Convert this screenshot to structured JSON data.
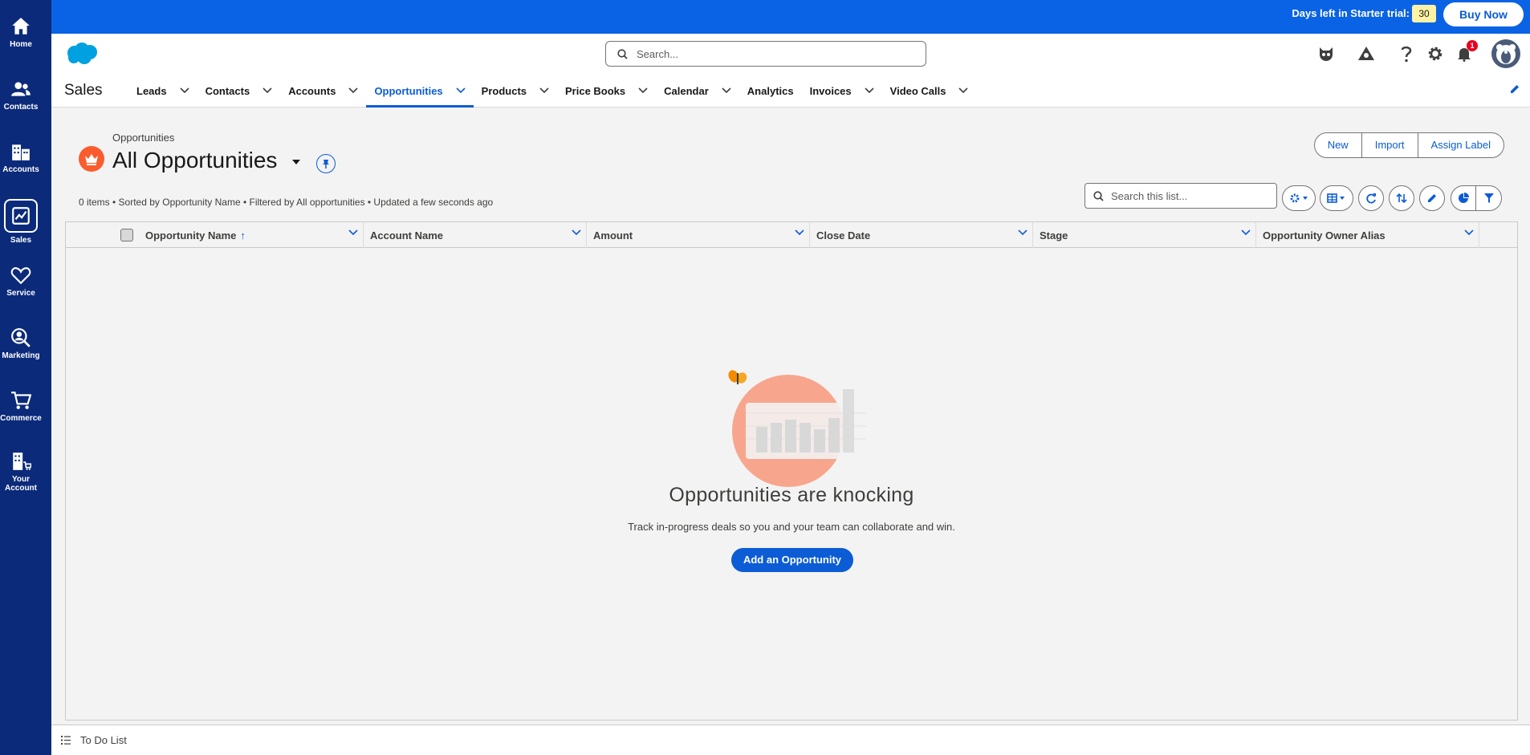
{
  "rail": {
    "items": [
      {
        "label": "Home",
        "icon": "home-icon"
      },
      {
        "label": "Contacts",
        "icon": "people-icon"
      },
      {
        "label": "Accounts",
        "icon": "building-icon"
      },
      {
        "label": "Sales",
        "icon": "chart-icon"
      },
      {
        "label": "Service",
        "icon": "heart-icon"
      },
      {
        "label": "Marketing",
        "icon": "search-person-icon"
      },
      {
        "label": "Commerce",
        "icon": "cart-icon"
      },
      {
        "label": "Your",
        "label2": "Account",
        "icon": "building-cart-icon"
      }
    ]
  },
  "trial": {
    "text": "Days left in Starter trial:",
    "days": "30",
    "buy": "Buy Now"
  },
  "header": {
    "search_placeholder": "Search...",
    "notification_count": "1"
  },
  "app": {
    "name": "Sales"
  },
  "nav": {
    "items": [
      "Leads",
      "Contacts",
      "Accounts",
      "Opportunities",
      "Products",
      "Price Books",
      "Calendar",
      "Analytics",
      "Invoices",
      "Video Calls"
    ],
    "active": "Opportunities"
  },
  "listview": {
    "object": "Opportunities",
    "title": "All Opportunities",
    "meta": "0 items • Sorted by Opportunity Name • Filtered by All opportunities • Updated a few seconds ago",
    "buttons": [
      "New",
      "Import",
      "Assign Label"
    ],
    "search_placeholder": "Search this list..."
  },
  "table": {
    "columns": [
      "Opportunity Name",
      "Account Name",
      "Amount",
      "Close Date",
      "Stage",
      "Opportunity Owner Alias"
    ],
    "sorted_column": "Opportunity Name",
    "rows": []
  },
  "empty": {
    "title": "Opportunities are knocking",
    "subtitle": "Track in-progress deals so you and your team can collaborate and win.",
    "button": "Add an Opportunity"
  },
  "footer": {
    "todo": "To Do List"
  },
  "colors": {
    "brand": "#0b5cd5",
    "rail": "#0b2a7a",
    "trialbar": "#0a63e4",
    "object_icon": "#f95d2e"
  }
}
